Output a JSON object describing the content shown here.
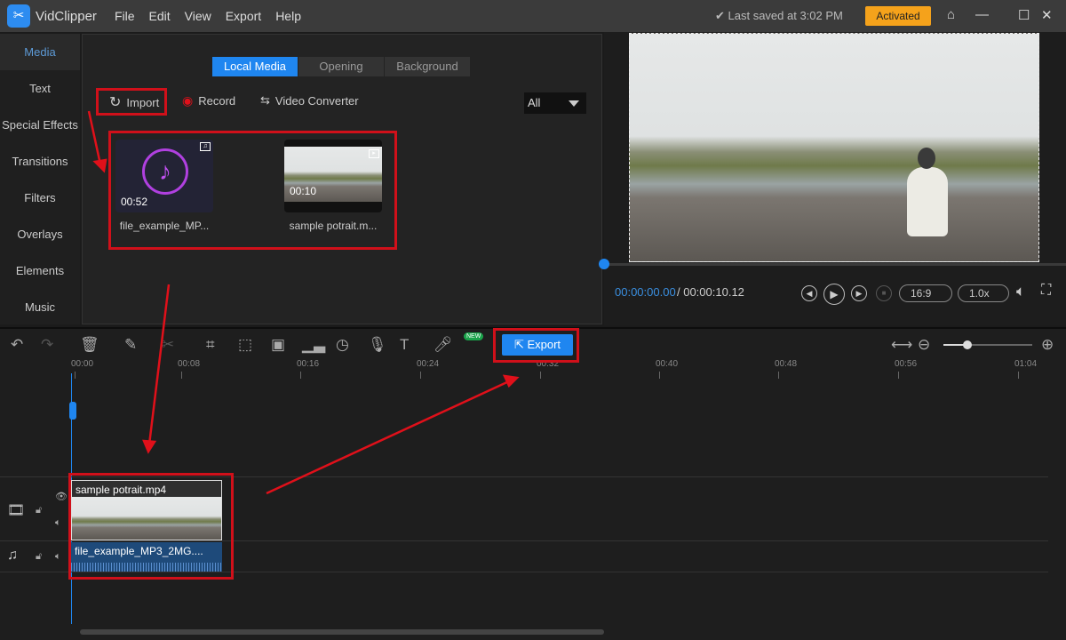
{
  "app": {
    "name": "VidClipper",
    "menu": [
      "File",
      "Edit",
      "View",
      "Export",
      "Help"
    ],
    "saved": "✔ Last saved at 3:02 PM",
    "activated": "Activated"
  },
  "sidebar": {
    "items": [
      "Media",
      "Text",
      "Special Effects",
      "Transitions",
      "Filters",
      "Overlays",
      "Elements",
      "Music"
    ]
  },
  "media": {
    "tabs": [
      "Local Media",
      "Opening",
      "Background"
    ],
    "import": "Import",
    "record": "Record",
    "converter": "Video Converter",
    "filter": "All",
    "items": [
      {
        "name": "file_example_MP...",
        "duration": "00:52",
        "type": "audio"
      },
      {
        "name": "sample potrait.m...",
        "duration": "00:10",
        "type": "video"
      }
    ]
  },
  "preview": {
    "current_time": "00:00:00.00",
    "total_time": "/ 00:00:10.12",
    "aspect": "16:9",
    "speed": "1.0x",
    "progress": 0
  },
  "timeline": {
    "export": "Export",
    "new_badge": "NEW",
    "ticks": [
      "00:00",
      "00:08",
      "00:16",
      "00:24",
      "00:32",
      "00:40",
      "00:48",
      "00:56",
      "01:04"
    ],
    "video_clip": "sample potrait.mp4",
    "audio_clip": "file_example_MP3_2MG....",
    "zoom_level": 0.2
  },
  "colors": {
    "accent": "#1f86f0",
    "annotation": "#d0101a",
    "activated": "#f5a21b"
  }
}
